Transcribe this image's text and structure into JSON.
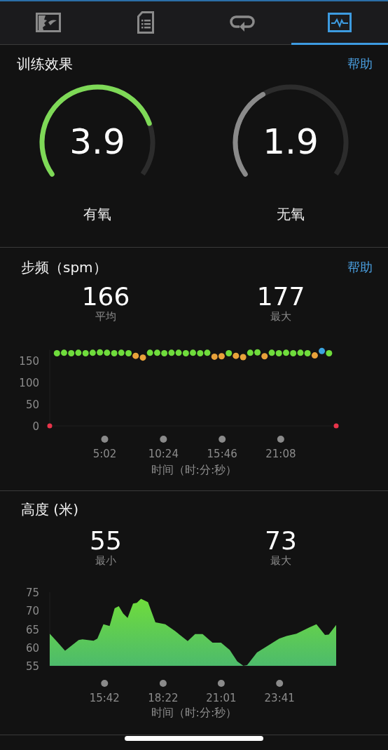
{
  "tabs": [
    {
      "kind": "map",
      "selected": false
    },
    {
      "kind": "details",
      "selected": false
    },
    {
      "kind": "laps",
      "selected": false
    },
    {
      "kind": "charts",
      "selected": true
    }
  ],
  "training_effect": {
    "title": "训练效果",
    "help": "帮助",
    "gauges": [
      {
        "value": "3.9",
        "label": "有氧",
        "color": "#7ed957"
      },
      {
        "value": "1.9",
        "label": "无氧",
        "color": "#8a8a8a"
      }
    ]
  },
  "cadence": {
    "title": "步频（spm）",
    "help": "帮助",
    "stats": [
      {
        "value": "166",
        "label": "平均"
      },
      {
        "value": "177",
        "label": "最大"
      }
    ],
    "chart_data": {
      "type": "scatter",
      "xlabel": "时间（时:分:秒）",
      "x": [
        0,
        0.66,
        1.31,
        1.97,
        2.62,
        3.28,
        3.93,
        4.59,
        5.24,
        5.9,
        6.55,
        7.21,
        7.86,
        8.52,
        9.17,
        9.83,
        10.48,
        11.14,
        11.79,
        12.45,
        13.1,
        13.76,
        14.41,
        15.07,
        15.72,
        16.38,
        17.03,
        17.69,
        18.34,
        19.0,
        19.65,
        20.31,
        20.96,
        21.62,
        22.27,
        22.93,
        23.58,
        24.24,
        24.89,
        25.55,
        26.2
      ],
      "series": [
        {
          "color": "#6fdc3c",
          "values": [
            null,
            167,
            168,
            167,
            168,
            167,
            168,
            169,
            168,
            167,
            168,
            167,
            null,
            null,
            168,
            168,
            167,
            168,
            168,
            167,
            168,
            167,
            168,
            null,
            null,
            167,
            null,
            null,
            168,
            169,
            null,
            168,
            167,
            168,
            167,
            168,
            167,
            null,
            null,
            167,
            null
          ]
        },
        {
          "color": "#e8a23a",
          "values": [
            null,
            null,
            null,
            null,
            null,
            null,
            null,
            null,
            null,
            null,
            null,
            null,
            161,
            157,
            null,
            null,
            null,
            null,
            null,
            null,
            null,
            null,
            null,
            159,
            160,
            null,
            161,
            158,
            null,
            null,
            160,
            null,
            null,
            null,
            null,
            null,
            null,
            162,
            null,
            null,
            null
          ]
        },
        {
          "color": "#3ba4e0",
          "values": [
            null,
            null,
            null,
            null,
            null,
            null,
            null,
            null,
            null,
            null,
            null,
            null,
            null,
            null,
            null,
            null,
            null,
            null,
            null,
            null,
            null,
            null,
            null,
            null,
            null,
            null,
            null,
            null,
            null,
            null,
            null,
            null,
            null,
            null,
            null,
            null,
            null,
            null,
            172,
            null,
            null
          ]
        },
        {
          "color": "#e8344a",
          "values": [
            0,
            null,
            null,
            null,
            null,
            null,
            null,
            null,
            null,
            null,
            null,
            null,
            null,
            null,
            null,
            null,
            null,
            null,
            null,
            null,
            null,
            null,
            null,
            null,
            null,
            null,
            null,
            null,
            null,
            null,
            null,
            null,
            null,
            null,
            null,
            null,
            null,
            null,
            null,
            null,
            0
          ]
        }
      ],
      "xlim": [
        0,
        26.2
      ],
      "ylim": [
        0,
        175
      ],
      "yticks": [
        0,
        50,
        100,
        150
      ],
      "xticks": [
        {
          "value": 5.03,
          "label": "5:02"
        },
        {
          "value": 10.4,
          "label": "10:24"
        },
        {
          "value": 15.77,
          "label": "15:46"
        },
        {
          "value": 21.13,
          "label": "21:08"
        }
      ]
    }
  },
  "altitude": {
    "title": "高度 (米)",
    "stats": [
      {
        "value": "55",
        "label": "最小"
      },
      {
        "value": "73",
        "label": "最大"
      }
    ],
    "chart_data": {
      "type": "area",
      "xlabel": "时间（时:分:秒）",
      "x": [
        13.2,
        13.51,
        13.9,
        14.52,
        14.69,
        15.2,
        15.37,
        15.65,
        15.93,
        16.16,
        16.35,
        16.55,
        16.75,
        17.0,
        17.17,
        17.36,
        17.68,
        18.02,
        18.47,
        18.92,
        19.49,
        19.83,
        20.17,
        20.62,
        21.01,
        21.41,
        21.75,
        22.03,
        22.2,
        22.65,
        23.1,
        23.66,
        24.0,
        24.45,
        25.02,
        25.36,
        25.75,
        25.92,
        26.26
      ],
      "series": [
        {
          "color": "#6fdc3c",
          "values": [
            63.7,
            61.7,
            59.1,
            62.0,
            62.2,
            61.8,
            62.4,
            66.3,
            65.8,
            70.6,
            71.2,
            69.2,
            68.0,
            71.9,
            72.1,
            73.2,
            72.3,
            66.8,
            66.3,
            64.4,
            61.7,
            63.6,
            63.6,
            61.3,
            61.3,
            59.3,
            56.2,
            55.0,
            55.2,
            58.6,
            60.3,
            62.4,
            63.1,
            63.7,
            65.4,
            66.3,
            63.4,
            63.5,
            66.1
          ]
        }
      ],
      "xlim": [
        13.2,
        26.26
      ],
      "ylim": [
        55,
        75
      ],
      "yticks": [
        55,
        60,
        65,
        70,
        75
      ],
      "xticks": [
        {
          "value": 15.7,
          "label": "15:42"
        },
        {
          "value": 18.37,
          "label": "18:22"
        },
        {
          "value": 21.02,
          "label": "21:01"
        },
        {
          "value": 23.68,
          "label": "23:41"
        }
      ]
    }
  }
}
